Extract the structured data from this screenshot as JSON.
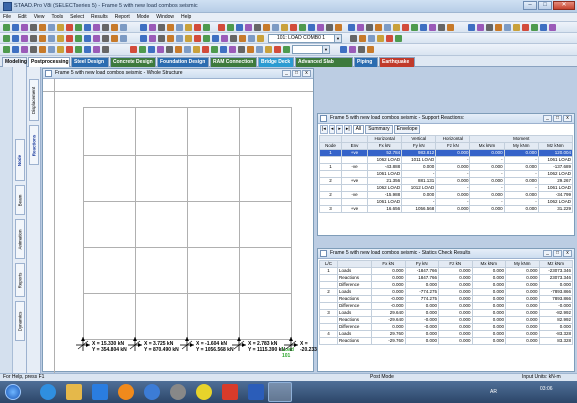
{
  "window": {
    "title": "STAAD.Pro V8i (SELECTseries 5) - Frame 5 with new load combos seismic"
  },
  "menu": [
    "File",
    "Edit",
    "View",
    "Tools",
    "Select",
    "Results",
    "Report",
    "Mode",
    "Window",
    "Help"
  ],
  "toolbar": {
    "load_case": "101: LOAD COMB0 1"
  },
  "tabs": [
    {
      "label": "Modeling",
      "colored": false
    },
    {
      "label": "Postprocessing",
      "colored": false,
      "selected": true
    },
    {
      "label": "Steel Design",
      "colored": true
    },
    {
      "label": "Concrete Design",
      "colored": true
    },
    {
      "label": "Foundation Design",
      "colored": true
    },
    {
      "label": "RAM Connection",
      "colored": true
    },
    {
      "label": "Bridge Deck",
      "colored": true
    },
    {
      "label": "Advanced Slab Design",
      "colored": true
    },
    {
      "label": "Piping",
      "colored": true
    },
    {
      "label": "Earthquake",
      "colored": true
    }
  ],
  "sidetabs": [
    "Node",
    "Beam",
    "Animation",
    "Reports",
    "Dynamics"
  ],
  "nodetabs": [
    "Displacement",
    "Reactions"
  ],
  "structure_window": {
    "title": "Frame 5 with new load combos seismic - Whole Structure",
    "reactions": [
      {
        "x": "X = 15.330 kN",
        "y": "Y = 354.804 kN",
        "z": "",
        "z_green": ""
      },
      {
        "x": "X = 3.725 kN",
        "y": "Y = 870.490 kN",
        "z": "",
        "z_green": ""
      },
      {
        "x": "X = -1.604 kN",
        "y": "Y = 1056.568 kN",
        "z": "",
        "z_green": ""
      },
      {
        "x": "X = 2.783 kN",
        "y": "Y = 1115.390 kN",
        "z": "",
        "z_green": "Load 101"
      },
      {
        "x": "X = -20.233",
        "y": "",
        "z": "",
        "z_green": ""
      }
    ]
  },
  "support_reactions": {
    "title": "Frame 5 with new load combos seismic - Support Reactions:",
    "subtabs": [
      "All",
      "Summary",
      "Envelope"
    ],
    "group_headers": [
      "Horizontal",
      "Vertical",
      "Horizontal",
      "Moment"
    ],
    "headers": [
      "Node",
      "Env",
      "Fx kN",
      "Fy kN",
      "Fz kN",
      "Mx kNm",
      "My kNm",
      "Mz kNm"
    ],
    "rows": [
      {
        "node": "1",
        "env": "+ve",
        "fx": "52.784",
        "fy": "983.812",
        "fz": "0.000",
        "mx": "0.000",
        "my": "0.000",
        "mz": "120.004",
        "hl": true
      },
      {
        "node": "",
        "env": "",
        "fx": "1062 LOAD",
        "fy": "1011 LOAD",
        "fz": "-",
        "mx": "-",
        "my": "-",
        "mz": "1061 LOAD",
        "hl": false
      },
      {
        "node": "1",
        "env": "-ve",
        "fx": "-43.888",
        "fy": "0.000",
        "fz": "0.000",
        "mx": "0.000",
        "my": "0.000",
        "mz": "-137.689",
        "hl": false
      },
      {
        "node": "",
        "env": "",
        "fx": "1061 LOAD",
        "fy": "-",
        "fz": "-",
        "mx": "-",
        "my": "-",
        "mz": "1062 LOAD",
        "hl": false
      },
      {
        "node": "2",
        "env": "+ve",
        "fx": "21.356",
        "fy": "881.131",
        "fz": "0.000",
        "mx": "0.000",
        "my": "0.000",
        "mz": "29.267",
        "hl": false
      },
      {
        "node": "",
        "env": "",
        "fx": "1062 LOAD",
        "fy": "1012 LOAD",
        "fz": "-",
        "mx": "-",
        "my": "-",
        "mz": "1061 LOAD",
        "hl": false
      },
      {
        "node": "2",
        "env": "-ve",
        "fx": "-15.988",
        "fy": "0.000",
        "fz": "0.000",
        "mx": "0.000",
        "my": "0.000",
        "mz": "-34.799",
        "hl": false
      },
      {
        "node": "",
        "env": "",
        "fx": "1061 LOAD",
        "fy": "-",
        "fz": "-",
        "mx": "-",
        "my": "-",
        "mz": "1062 LOAD",
        "hl": false
      },
      {
        "node": "3",
        "env": "+ve",
        "fx": "16.656",
        "fy": "1056.568",
        "fz": "0.000",
        "mx": "0.000",
        "my": "0.000",
        "mz": "31.229",
        "hl": false
      }
    ]
  },
  "statics_check": {
    "title": "Frame 5 with new load combos seismic - Statics Check Results",
    "headers": [
      "L/C",
      "",
      "Fx kN",
      "Fy kN",
      "Fz kN",
      "Mx kNm",
      "My kNm",
      "Mz kNm"
    ],
    "rows": [
      {
        "lc": "1",
        "type": "Loads",
        "fx": "0.000",
        "fy": "-1847.766",
        "fz": "0.000",
        "mx": "0.000",
        "my": "0.000",
        "mz": "-23073.346"
      },
      {
        "lc": "",
        "type": "Reactions",
        "fx": "0.000",
        "fy": "1847.766",
        "fz": "0.000",
        "mx": "0.000",
        "my": "0.000",
        "mz": "23073.346"
      },
      {
        "lc": "",
        "type": "Difference",
        "fx": "0.000",
        "fy": "0.000",
        "fz": "0.000",
        "mx": "0.000",
        "my": "0.000",
        "mz": "0.000"
      },
      {
        "lc": "2",
        "type": "Loads",
        "fx": "0.000",
        "fy": "-774.275",
        "fz": "0.000",
        "mx": "0.000",
        "my": "0.000",
        "mz": "-7893.866"
      },
      {
        "lc": "",
        "type": "Reactions",
        "fx": "-0.000",
        "fy": "774.275",
        "fz": "0.000",
        "mx": "0.000",
        "my": "0.000",
        "mz": "7893.866"
      },
      {
        "lc": "",
        "type": "Difference",
        "fx": "-0.000",
        "fy": "0.000",
        "fz": "0.000",
        "mx": "0.000",
        "my": "0.000",
        "mz": "-0.000"
      },
      {
        "lc": "3",
        "type": "Loads",
        "fx": "29.640",
        "fy": "0.000",
        "fz": "0.000",
        "mx": "0.000",
        "my": "0.000",
        "mz": "-82.992"
      },
      {
        "lc": "",
        "type": "Reactions",
        "fx": "-29.640",
        "fy": "-0.000",
        "fz": "0.000",
        "mx": "0.000",
        "my": "0.000",
        "mz": "82.992"
      },
      {
        "lc": "",
        "type": "Difference",
        "fx": "0.000",
        "fy": "-0.000",
        "fz": "0.000",
        "mx": "0.000",
        "my": "0.000",
        "mz": "0.000"
      },
      {
        "lc": "4",
        "type": "Loads",
        "fx": "29.760",
        "fy": "0.000",
        "fz": "0.000",
        "mx": "0.000",
        "my": "0.000",
        "mz": "-83.328"
      },
      {
        "lc": "",
        "type": "Reactions",
        "fx": "-29.760",
        "fy": "0.000",
        "fz": "0.000",
        "mx": "0.000",
        "my": "0.000",
        "mz": "83.328"
      }
    ]
  },
  "status": {
    "help": "For Help, press F1",
    "mode": "Post Mode",
    "units": "Input Units: kN-m"
  },
  "taskbar": {
    "time": "03:06",
    "lang": "AR"
  }
}
